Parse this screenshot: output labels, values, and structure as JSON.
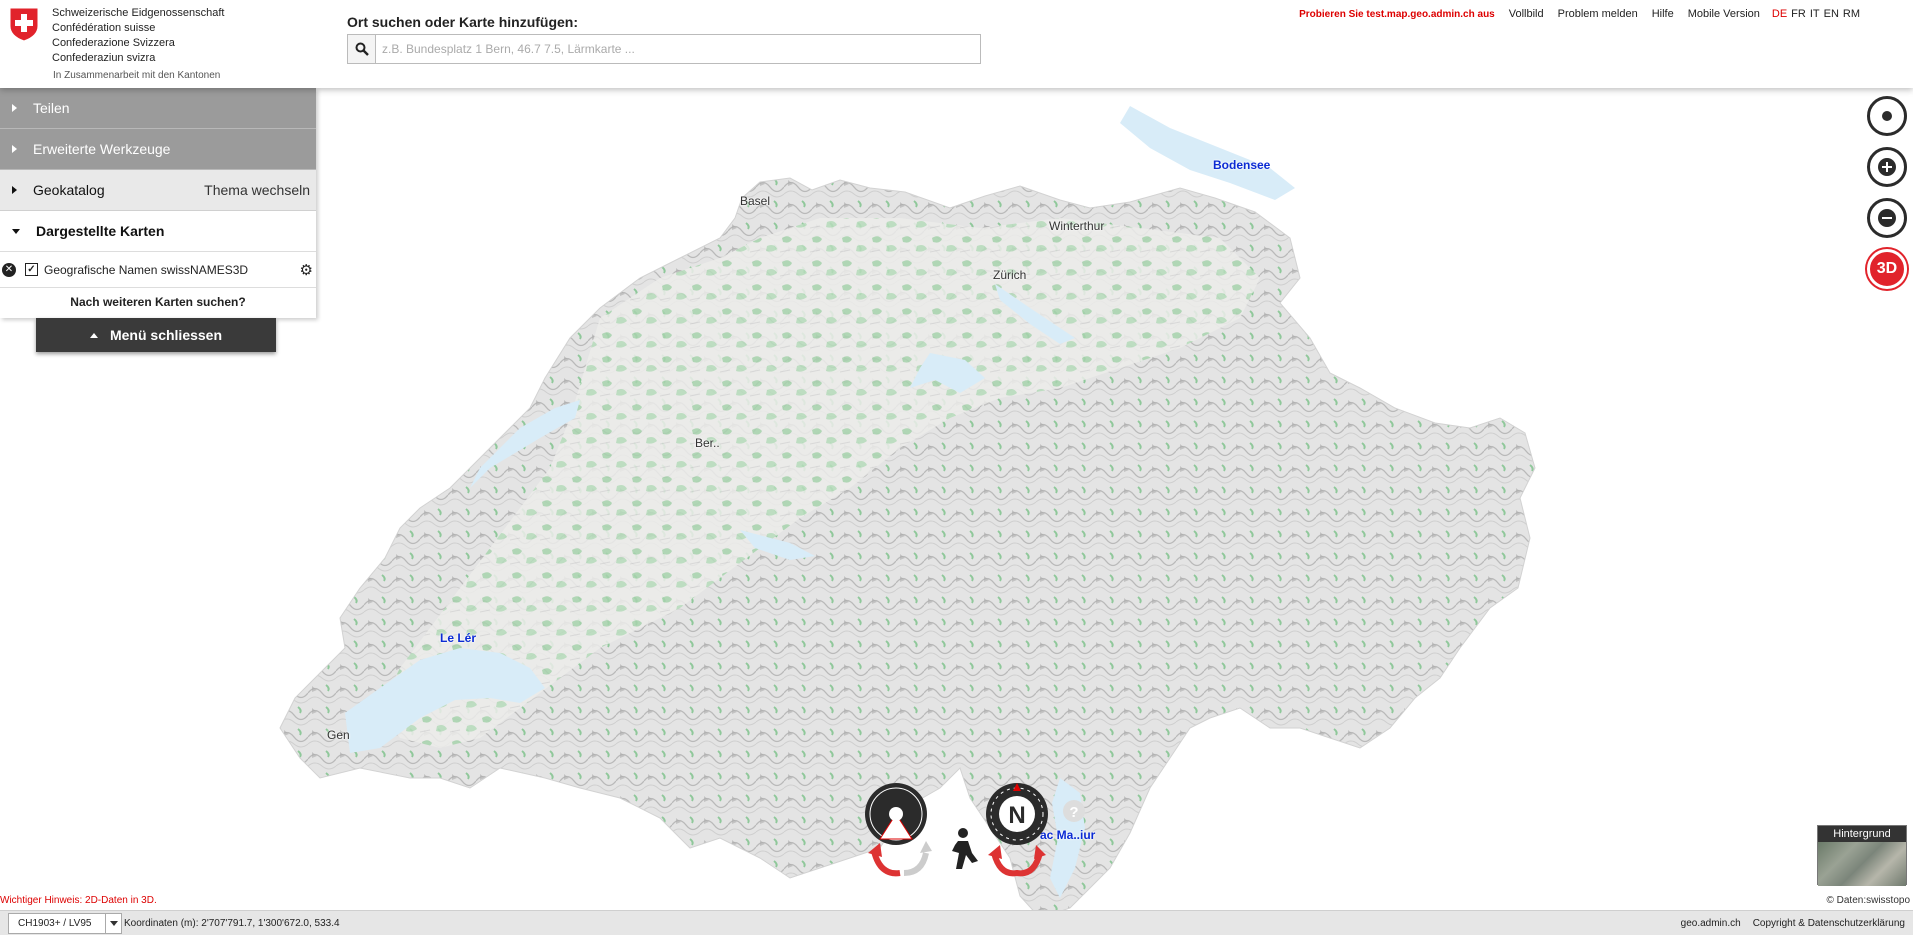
{
  "header": {
    "logo_lines": [
      "Schweizerische Eidgenossenschaft",
      "Confédération suisse",
      "Confederazione Svizzera",
      "Confederaziun svizra"
    ],
    "logo_sub": "In Zusammenarbeit mit den Kantonen",
    "search_title": "Ort suchen oder Karte hinzufügen:",
    "search_placeholder": "z.B. Bundesplatz 1 Bern, 46.7 7.5, Lärmkarte ...",
    "try_link": "Probieren Sie test.map.geo.admin.ch aus",
    "links": [
      "Vollbild",
      "Problem melden",
      "Hilfe",
      "Mobile Version"
    ],
    "languages": [
      "DE",
      "FR",
      "IT",
      "EN",
      "RM"
    ],
    "active_language": "DE"
  },
  "menu": {
    "share": "Teilen",
    "advanced_tools": "Erweiterte Werkzeuge",
    "geocatalog": "Geokatalog",
    "change_theme": "Thema wechseln",
    "displayed_maps": "Dargestellte Karten",
    "layers": [
      {
        "name": "Geografische Namen swissNAMES3D",
        "checked": true
      }
    ],
    "more_maps": "Nach weiteren Karten suchen?",
    "close_menu": "Menü schliessen"
  },
  "map": {
    "labels": [
      {
        "text": "Basel",
        "kind": "place"
      },
      {
        "text": "Winterthur",
        "kind": "place"
      },
      {
        "text": "Zürich",
        "kind": "place"
      },
      {
        "text": "Ber..",
        "kind": "place"
      },
      {
        "text": "Le Lér",
        "kind": "water"
      },
      {
        "text": "Gen",
        "kind": "place"
      },
      {
        "text": "Bodensee",
        "kind": "water"
      },
      {
        "text": "ac Ma..iur",
        "kind": "water"
      }
    ],
    "controls": [
      "locate-icon",
      "zoom-in-icon",
      "zoom-out-icon",
      "3d-icon"
    ],
    "button_3d_label": "3D",
    "compass_label": "N"
  },
  "background_selector": {
    "label": "Hintergrund"
  },
  "attribution": "© Daten:swisstopo",
  "hint": "Wichtiger Hinweis: 2D-Daten in 3D.",
  "footer": {
    "projection": "CH1903+ / LV95",
    "coordinates": "Koordinaten (m): 2'707'791.7, 1'300'672.0, 533.4",
    "links": [
      "geo.admin.ch",
      "Copyright & Datenschutzerklärung"
    ]
  },
  "colors": {
    "accent": "#e1232b",
    "water": "#0b2bd4",
    "lake": "#d8ecf8",
    "forest": "#8fc89a"
  }
}
